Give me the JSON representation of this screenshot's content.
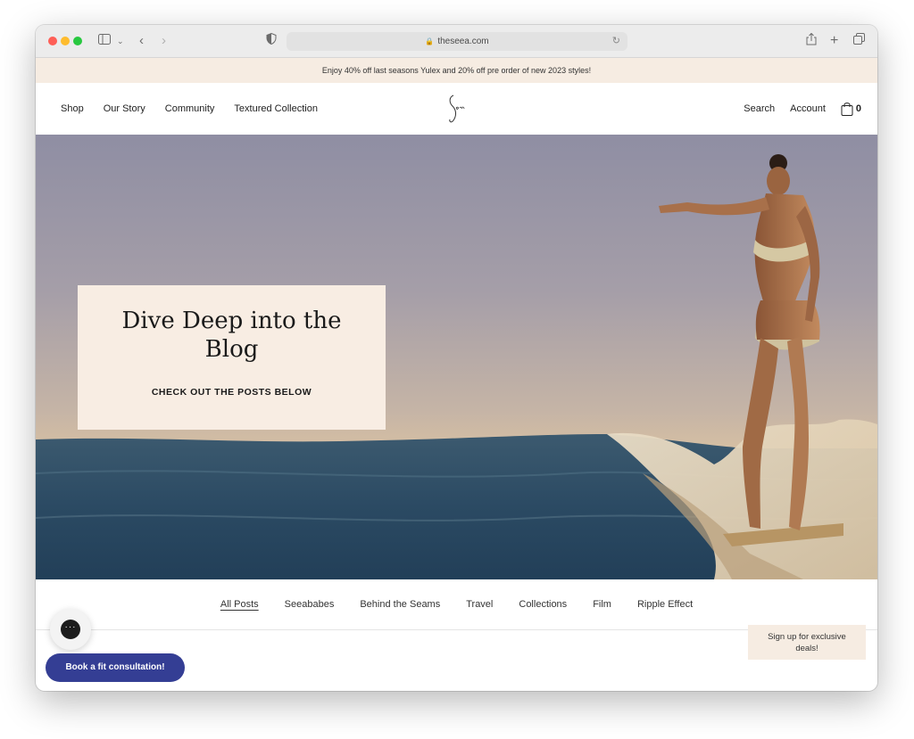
{
  "browser": {
    "url": "theseea.com"
  },
  "announcement": "Enjoy 40% off last seasons Yulex and 20% off pre order of new 2023 styles!",
  "header": {
    "nav_left": [
      "Shop",
      "Our Story",
      "Community",
      "Textured Collection"
    ],
    "search_label": "Search",
    "account_label": "Account",
    "cart_count": "0"
  },
  "hero": {
    "title": "Dive Deep into the Blog",
    "subtitle": "CHECK OUT THE POSTS BELOW"
  },
  "categories": [
    "All Posts",
    "Seeababes",
    "Behind the Seams",
    "Travel",
    "Collections",
    "Film",
    "Ripple Effect"
  ],
  "widgets": {
    "fit_button": "Book a fit consultation!",
    "signup_text": "Sign up for exclusive deals!"
  },
  "colors": {
    "announce_bg": "#f6ece2",
    "fit_button_bg": "#343e94",
    "card_bg": "#f8ede3"
  }
}
